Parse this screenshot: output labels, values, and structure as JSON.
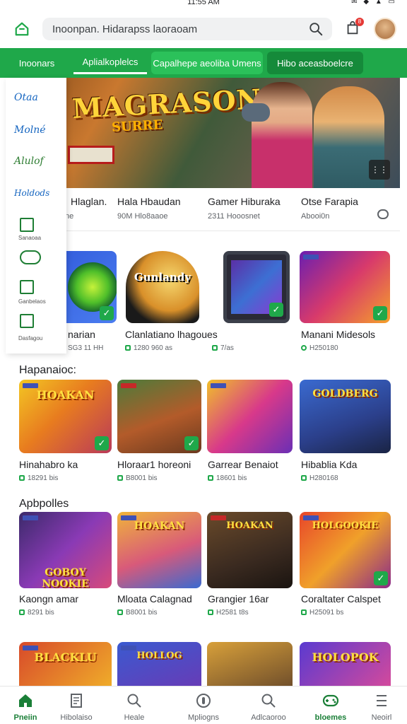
{
  "status": {
    "time": "11:55 AM",
    "icons": "✉ ◆ ▲ ▭"
  },
  "header": {
    "search_placeholder": "Inoonpan. Hidarapss laoraoam",
    "cart_badge": "8"
  },
  "tabs": [
    {
      "label": "Inoonars"
    },
    {
      "label": "Aplialkoplelcs"
    },
    {
      "label": "Capalhepe aeoliba Umens"
    },
    {
      "label": "Hibo aceasboelcre"
    }
  ],
  "hero": {
    "title": "MAGRASON",
    "subtitle": "SURRE"
  },
  "drawer": {
    "items": [
      "Otaa",
      "Molné",
      "Alulof",
      "Holdods"
    ],
    "icon_labels": [
      "Sanaoaa",
      "Ganbelaos",
      "Dasfagou"
    ]
  },
  "featured_row": {
    "items": [
      {
        "title": "Hlaglan.",
        "sub": "ne"
      },
      {
        "title": "Hala Hbaudan",
        "sub": "90M Hlo8aaoe"
      },
      {
        "title": "Gamer Hiburaka",
        "sub": "2311 Hooosnet"
      },
      {
        "title": "Otse Farapia",
        "sub": "Abooi0n"
      }
    ]
  },
  "apps_row": {
    "items": [
      {
        "title": "narian",
        "sub": "SG3 11 HH"
      },
      {
        "title": "Clanlatiano lhagoues",
        "sub": "1280 960 as"
      },
      {
        "title": "",
        "sub": "7/as"
      },
      {
        "title": "Manani Midesols",
        "sub": "H250180"
      }
    ]
  },
  "sections": [
    {
      "title": "Hapanaioc:",
      "games": [
        {
          "title": "Hinahabro ka",
          "sub": "18291 bis",
          "art": "HOAKAN"
        },
        {
          "title": "Hloraar1 horeoni",
          "sub": "B8001 bis",
          "art": ""
        },
        {
          "title": "Garrear Benaiot",
          "sub": "18601 bis",
          "art": ""
        },
        {
          "title": "Hibablia Kda",
          "sub": "H280168",
          "art": "GOLDBERG"
        }
      ]
    },
    {
      "title": "Apbpolles",
      "games": [
        {
          "title": "Kaongn amar",
          "sub": "8291 bis",
          "art": "GOBOY NOOKIE"
        },
        {
          "title": "Mloata Calagnad",
          "sub": "B8001 bis",
          "art": "HOAKAN"
        },
        {
          "title": "Grangier 16ar",
          "sub": "H2581 t8s",
          "art": "HOAKAN"
        },
        {
          "title": "Coraltater Calspet",
          "sub": "H25091 bs",
          "art": "HOLGOOKIE"
        }
      ]
    },
    {
      "title": "",
      "games": [
        {
          "title": "",
          "sub": "",
          "art": "BLACKLU"
        },
        {
          "title": "",
          "sub": "",
          "art": "HOLLOG"
        },
        {
          "title": "",
          "sub": "",
          "art": ""
        },
        {
          "title": "",
          "sub": "",
          "art": "HOLOPOK"
        }
      ]
    }
  ],
  "bottom_nav": [
    {
      "label": "Pneiin",
      "icon": "home-icon",
      "active": true
    },
    {
      "label": "Hibolaiso",
      "icon": "document-icon"
    },
    {
      "label": "Heale",
      "icon": "search-icon"
    },
    {
      "label": "Mpliogns",
      "icon": "coin-icon"
    },
    {
      "label": "Adlcaoroo",
      "icon": "search-icon"
    },
    {
      "label": "bloemes",
      "icon": "games-icon",
      "active": true
    },
    {
      "label": "Neoirl",
      "icon": "menu-icon"
    }
  ],
  "colors": {
    "brand_green": "#1fa84a",
    "active_green": "#1a7f37",
    "badge_red": "#e53935"
  }
}
